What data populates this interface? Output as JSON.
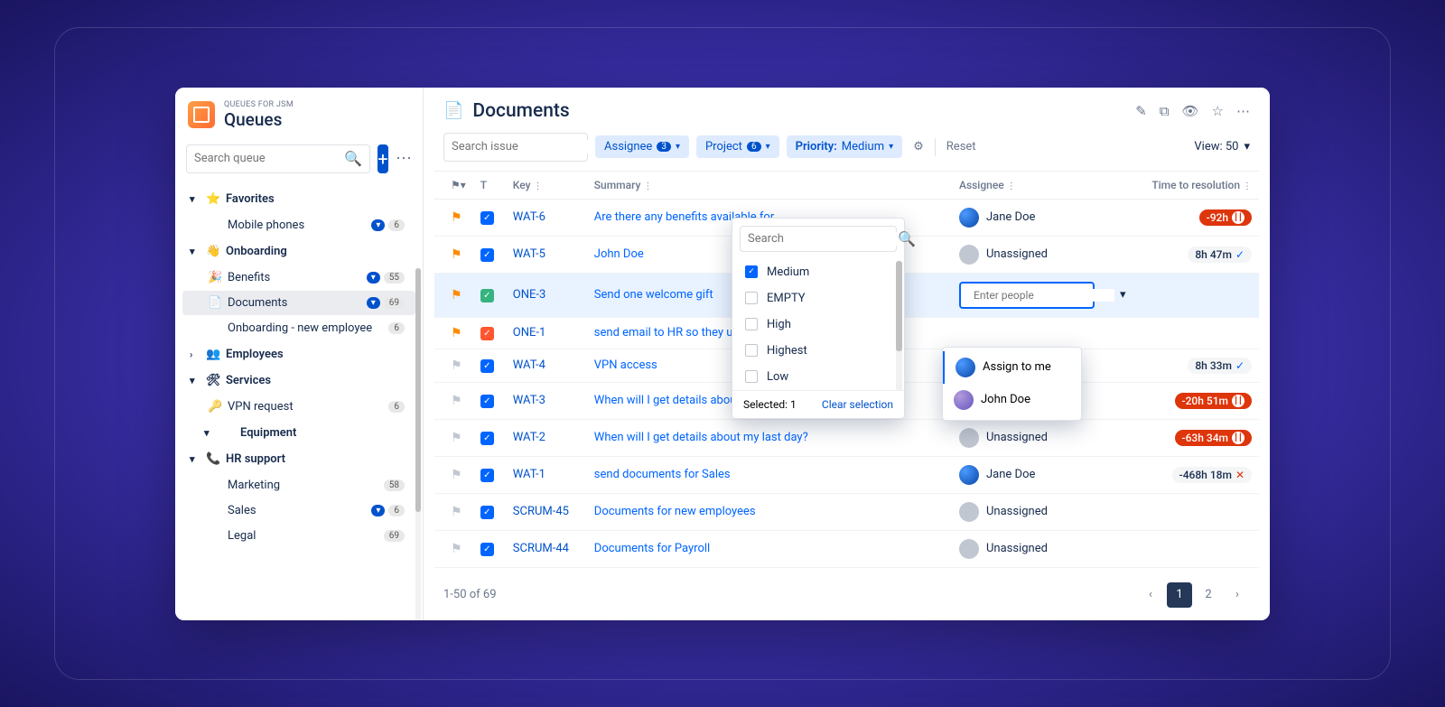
{
  "brand": {
    "overline": "QUEUES FOR JSM",
    "title": "Queues"
  },
  "sidebar": {
    "search_placeholder": "Search queue",
    "groups": [
      {
        "caret": "▾",
        "icon": "⭐",
        "label": "Favorites",
        "items": [
          {
            "icon": "",
            "label": "Mobile phones",
            "filter": true,
            "count": "6"
          }
        ]
      },
      {
        "caret": "▾",
        "icon": "👋",
        "label": "Onboarding",
        "items": [
          {
            "icon": "🎉",
            "label": "Benefits",
            "filter": true,
            "count": "55"
          },
          {
            "icon": "📄",
            "label": "Documents",
            "filter": true,
            "count": "69",
            "active": true
          },
          {
            "icon": "",
            "label": "Onboarding - new employee",
            "count": "6"
          }
        ]
      },
      {
        "caret": "›",
        "icon": "👥",
        "label": "Employees",
        "items": []
      },
      {
        "caret": "▾",
        "icon": "🛠",
        "label": "Services",
        "items": [
          {
            "icon": "🔑",
            "label": "VPN request",
            "count": "6"
          }
        ]
      },
      {
        "caret": "▾",
        "icon": "",
        "label": "Equipment",
        "indent": true,
        "items": []
      },
      {
        "caret": "▾",
        "icon": "📞",
        "label": "HR support",
        "hr": true,
        "items": [
          {
            "icon": "",
            "label": "Marketing",
            "count": "58"
          },
          {
            "icon": "",
            "label": "Sales",
            "filter": true,
            "count": "6"
          },
          {
            "icon": "",
            "label": "Legal",
            "count": "69"
          }
        ]
      }
    ]
  },
  "main": {
    "title": "Documents",
    "issue_search_placeholder": "Search issue",
    "filter_assignee": {
      "label": "Assignee",
      "count": "3"
    },
    "filter_project": {
      "label": "Project",
      "count": "6"
    },
    "filter_priority": {
      "label": "Priority:",
      "value": "Medium"
    },
    "reset": "Reset",
    "view_label": "View: 50"
  },
  "columns": {
    "t": "T",
    "key": "Key",
    "summary": "Summary",
    "assignee": "Assignee",
    "ttr": "Time to resolution"
  },
  "rows": [
    {
      "flag": "on",
      "chk": "blue",
      "key": "WAT-6",
      "summary": "Are there any benefits available for",
      "assignee": "Jane Doe",
      "avatar": "jd",
      "sla": {
        "style": "red",
        "text": "-92h",
        "icon": "pause"
      }
    },
    {
      "flag": "on",
      "chk": "blue",
      "key": "WAT-5",
      "summary": "John Doe",
      "assignee": "Unassigned",
      "avatar": "",
      "sla": {
        "style": "gray",
        "text": "8h 47m",
        "icon": "check"
      }
    },
    {
      "flag": "on",
      "chk": "green",
      "key": "ONE-3",
      "summary": "Send one welcome gift",
      "assignee": "enter",
      "avatar": "",
      "sla": null,
      "sel": true
    },
    {
      "flag": "on",
      "chk": "red",
      "key": "ONE-1",
      "summary": "send email to HR so they upload",
      "assignee": "",
      "avatar": "",
      "sla": null
    },
    {
      "flag": "off",
      "chk": "blue",
      "key": "WAT-4",
      "summary": "VPN access",
      "assignee": "",
      "avatar": "",
      "sla": {
        "style": "gray",
        "text": "8h 33m",
        "icon": "check"
      }
    },
    {
      "flag": "off",
      "chk": "blue",
      "key": "WAT-3",
      "summary": "When will I get details about my first day?",
      "assignee": "John Doe",
      "avatar": "jo",
      "sla": {
        "style": "red",
        "text": "-20h 51m",
        "icon": "pause"
      }
    },
    {
      "flag": "off",
      "chk": "blue",
      "key": "WAT-2",
      "summary": "When will I get details about my last day?",
      "assignee": "Unassigned",
      "avatar": "",
      "sla": {
        "style": "red",
        "text": "-63h 34m",
        "icon": "pause"
      }
    },
    {
      "flag": "off",
      "chk": "blue",
      "key": "WAT-1",
      "summary": "send documents for Sales",
      "assignee": "Jane Doe",
      "avatar": "jd",
      "sla": {
        "style": "gray",
        "text": "-468h 18m",
        "icon": "x"
      }
    },
    {
      "flag": "off",
      "chk": "blue",
      "key": "SCRUM-45",
      "summary": "Documents for new employees",
      "assignee": "Unassigned",
      "avatar": "",
      "sla": null
    },
    {
      "flag": "off",
      "chk": "blue",
      "key": "SCRUM-44",
      "summary": "Documents for Payroll",
      "assignee": "Unassigned",
      "avatar": "",
      "sla": null
    }
  ],
  "priority_popover": {
    "search_placeholder": "Search",
    "options": [
      {
        "label": "Medium",
        "checked": true
      },
      {
        "label": "EMPTY",
        "checked": false
      },
      {
        "label": "High",
        "checked": false
      },
      {
        "label": "Highest",
        "checked": false
      },
      {
        "label": "Low",
        "checked": false
      }
    ],
    "selected_text": "Selected: 1",
    "clear_text": "Clear selection"
  },
  "assignee_popover": {
    "placeholder": "Enter people",
    "options": [
      {
        "label": "Assign to me",
        "avatar": "jd"
      },
      {
        "label": "John Doe",
        "avatar": "jo"
      }
    ]
  },
  "footer": {
    "range": "1-50 of 69",
    "pages": [
      "1",
      "2"
    ]
  }
}
